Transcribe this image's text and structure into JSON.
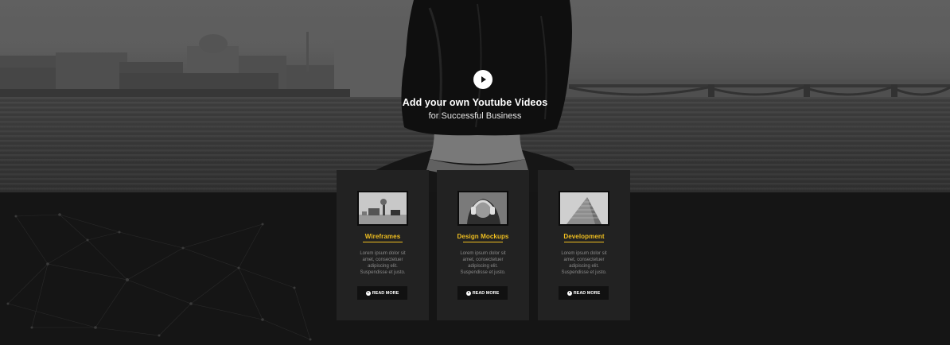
{
  "hero": {
    "title": "Add your own Youtube Videos",
    "subtitle": "for Successful Business",
    "play_icon": "play-icon"
  },
  "cards": [
    {
      "title": "Wireframes",
      "text": "Lorem ipsum dolor sit amet, consectetuer adipiscing elit. Suspendisse et justo.",
      "button": "READ MORE",
      "thumb_icon": "desk-photo-icon"
    },
    {
      "title": "Design Mockups",
      "text": "Lorem ipsum dolor sit amet, consectetuer adipiscing elit. Suspendisse et justo.",
      "button": "READ MORE",
      "thumb_icon": "headphones-photo-icon"
    },
    {
      "title": "Development",
      "text": "Lorem ipsum dolor sit amet, consectetuer adipiscing elit. Suspendisse et justo.",
      "button": "READ MORE",
      "thumb_icon": "building-photo-icon"
    }
  ],
  "colors": {
    "accent": "#f0bf20",
    "card_bg": "#222222",
    "section_bg": "#151515",
    "button_bg": "#111111"
  }
}
